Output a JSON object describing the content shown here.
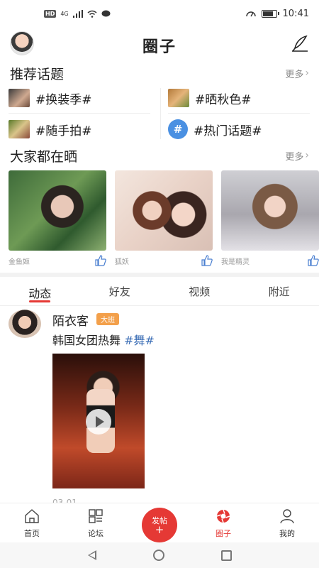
{
  "status_bar": {
    "network": "HD",
    "signal": "4G",
    "time": "10:41"
  },
  "header": {
    "title": "圈子",
    "avatar_icon": "user-avatar",
    "compose_icon": "quill-icon"
  },
  "topics_section": {
    "title": "推荐话题",
    "more": "更多",
    "items": [
      {
        "label": "#换装季#"
      },
      {
        "label": "#晒秋色#"
      },
      {
        "label": "#随手拍#"
      },
      {
        "label": "#热门话题#",
        "badge": "#"
      }
    ]
  },
  "showcase_section": {
    "title": "大家都在晒",
    "more": "更多",
    "cards": [
      {
        "name": "金鱼姬"
      },
      {
        "name": "狐妖"
      },
      {
        "name": "我是精灵"
      }
    ]
  },
  "feed_tabs": [
    {
      "label": "动态"
    },
    {
      "label": "好友"
    },
    {
      "label": "视频"
    },
    {
      "label": "附近"
    }
  ],
  "post": {
    "user": "陌衣客",
    "badge": "大班",
    "text": "韩国女团热舞",
    "hashtag": "#舞#",
    "date": "03-01"
  },
  "bottom_nav": [
    {
      "label": "首页",
      "icon": "home-icon"
    },
    {
      "label": "论坛",
      "icon": "forum-icon"
    },
    {
      "label": "发帖",
      "plus": "+",
      "icon": "new-post"
    },
    {
      "label": "圈子",
      "icon": "circle-icon"
    },
    {
      "label": "我的",
      "icon": "profile-icon"
    }
  ],
  "colors": {
    "accent": "#e53935",
    "hashtag": "#3d6fb6",
    "badge": "#f3a04b"
  }
}
